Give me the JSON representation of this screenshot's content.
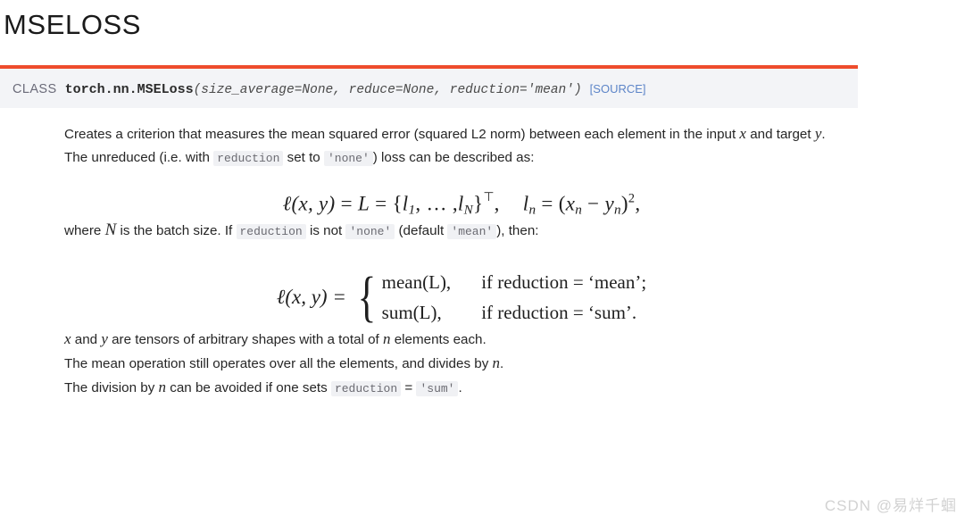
{
  "page": {
    "title": "MSELOSS",
    "watermark": "CSDN @易烊千蝈"
  },
  "signature": {
    "class_keyword": "CLASS",
    "qualified_name": "torch.nn.MSELoss",
    "params": "(size_average=None, reduce=None, reduction='mean')",
    "source_link": "[SOURCE]",
    "accent_color": "#ee4c2c",
    "background_color": "#f3f4f7",
    "link_color": "#5d85c8"
  },
  "body": {
    "p1": {
      "part1": "Creates a criterion that measures the mean squared error (squared L2 norm) between each element in the input ",
      "var1": "x",
      "part2": " and target ",
      "var2": "y",
      "part3": "."
    },
    "p2": {
      "part1": "The unreduced (i.e. with ",
      "code1": "reduction",
      "part2": " set to ",
      "code2": "'none'",
      "part3": ") loss can be described as:"
    },
    "p3": {
      "part1": "where ",
      "var1": "N",
      "part2": " is the batch size. If ",
      "code1": "reduction",
      "part3": " is not ",
      "code2": "'none'",
      "part4": " (default ",
      "code3": "'mean'",
      "part5": "), then:"
    },
    "p4": {
      "var1": "x",
      "part1": " and ",
      "var2": "y",
      "part2": " are tensors of arbitrary shapes with a total of ",
      "var3": "n",
      "part3": " elements each."
    },
    "p5": {
      "part1": "The mean operation still operates over all the elements, and divides by ",
      "var1": "n",
      "part2": "."
    },
    "p6": {
      "part1": "The division by ",
      "var1": "n",
      "part2": " can be avoided if one sets ",
      "code1": "reduction",
      "part3": " = ",
      "code2": "'sum'",
      "part4": "."
    }
  },
  "equations": {
    "eq1": {
      "lhs_ell": "ℓ",
      "lhs_args": "(x, y)",
      "eq_sign_1": "=",
      "L": "L",
      "eq_sign_2": "=",
      "open_brace": "{",
      "l_sub1": "l",
      "sub1": "1",
      "ellipsis": ", … ,",
      "l_subN": "l",
      "subN": "N",
      "close_brace": "}",
      "transpose": "⊤",
      "comma1": ",",
      "rhs_l": "l",
      "rhs_sub_n": "n",
      "rhs_eq": "=",
      "rhs_open": "(",
      "rhs_x": "x",
      "rhs_x_sub": "n",
      "rhs_minus": "−",
      "rhs_y": "y",
      "rhs_y_sub": "n",
      "rhs_close": ")",
      "rhs_pow": "2",
      "comma2": ","
    },
    "eq2": {
      "lhs": "ℓ(x, y) =",
      "brace": "{",
      "case1_left": "mean(L),",
      "case1_right": "if reduction = ‘mean’;",
      "case2_left": "sum(L),",
      "case2_right": "if reduction = ‘sum’."
    }
  }
}
